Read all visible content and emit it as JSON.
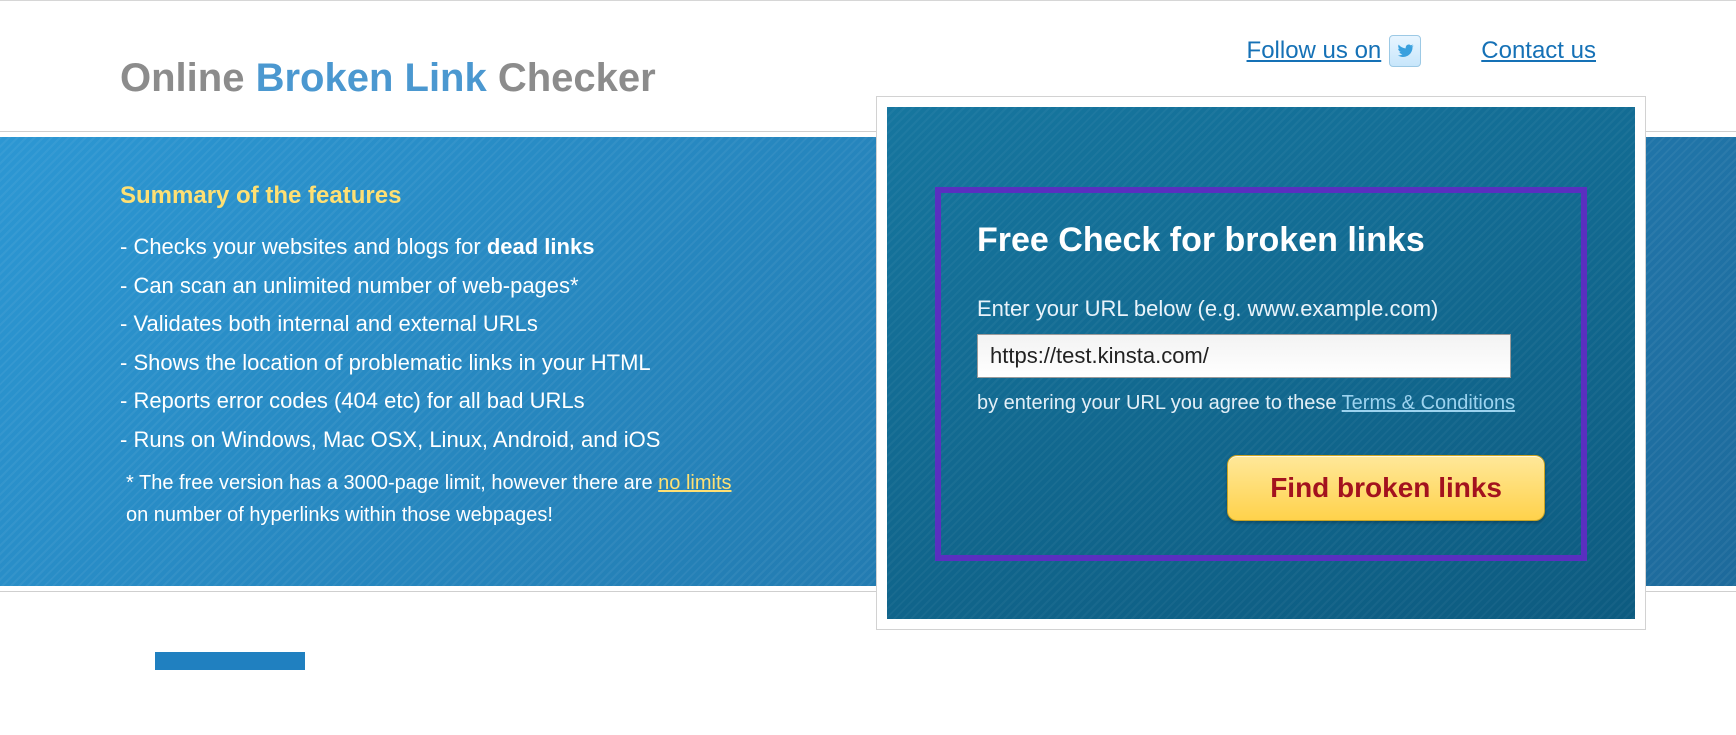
{
  "nav": {
    "follow_label": "Follow us on",
    "contact_label": "Contact us"
  },
  "logo": {
    "part1": "Online ",
    "part2": "Broken Link",
    "part3": " Checker"
  },
  "summary": {
    "title": "Summary of the features",
    "f1_prefix": "- Checks your websites and blogs for ",
    "f1_bold": "dead links",
    "f2": "- Can scan an unlimited number of web-pages*",
    "f3": "- Validates both internal and external URLs",
    "f4": "- Shows the location of problematic links in your HTML",
    "f5": "- Reports error codes (404 etc) for all bad URLs",
    "f6": "- Runs on Windows, Mac OSX, Linux, Android, and iOS",
    "foot_pre": "*  The free version has a 3000-page limit, however there are ",
    "foot_link": "no limits",
    "foot_post": " on number of hyperlinks within those webpages!"
  },
  "form": {
    "title": "Free Check for broken links",
    "label": "Enter your URL below (e.g. www.example.com)",
    "value": "https://test.kinsta.com/",
    "terms_pre": "by entering your URL you agree to these ",
    "terms_link": "Terms & Conditions",
    "button": "Find broken links"
  }
}
